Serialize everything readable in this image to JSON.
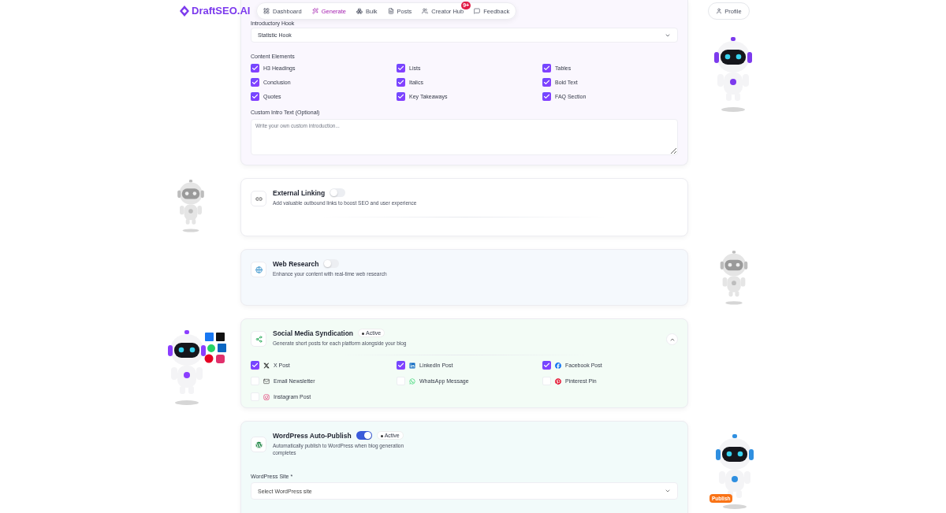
{
  "brand": {
    "name": "DraftSEO.AI"
  },
  "nav": [
    {
      "label": "Dashboard",
      "selected": false,
      "kind": "dashboard"
    },
    {
      "label": "Generate",
      "selected": true,
      "kind": "generate"
    },
    {
      "label": "Bulk",
      "selected": false,
      "kind": "bulk"
    },
    {
      "label": "Posts",
      "selected": false,
      "kind": "posts"
    },
    {
      "label": "Creator Hub",
      "selected": false,
      "kind": "hub",
      "badge": "9+"
    },
    {
      "label": "Feedback",
      "selected": false,
      "kind": "feedback"
    }
  ],
  "profile": {
    "label": "Profile"
  },
  "structure": {
    "hook_label": "Introductory Hook",
    "hook_value": "Statistic Hook",
    "elements_label": "Content Elements",
    "elements": [
      {
        "label": "H3 Headings",
        "checked": true
      },
      {
        "label": "Lists",
        "checked": true
      },
      {
        "label": "Tables",
        "checked": true
      },
      {
        "label": "Conclusion",
        "checked": true
      },
      {
        "label": "Italics",
        "checked": true
      },
      {
        "label": "Bold Text",
        "checked": true
      },
      {
        "label": "Quotes",
        "checked": true
      },
      {
        "label": "Key Takeaways",
        "checked": true
      },
      {
        "label": "FAQ Section",
        "checked": true
      }
    ],
    "intro_label": "Custom Intro Text (Optional)",
    "intro_placeholder": "Write your own custom introduction..."
  },
  "external_linking": {
    "title": "External Linking",
    "description": "Add valuable outbound links to boost SEO and user experience",
    "on": false
  },
  "web_research": {
    "title": "Web Research",
    "description": "Enhance your content with real-time web research",
    "on": false
  },
  "social": {
    "title": "Social Media Syndication",
    "status": "Active",
    "description": "Generate short posts for each platform alongside your blog",
    "expanded": true,
    "options": [
      {
        "label": "X Post",
        "checked": true,
        "kind": "x"
      },
      {
        "label": "LinkedIn Post",
        "checked": true,
        "kind": "linkedin"
      },
      {
        "label": "Facebook Post",
        "checked": true,
        "kind": "facebook"
      },
      {
        "label": "Email Newsletter",
        "checked": false,
        "kind": "email"
      },
      {
        "label": "WhatsApp Message",
        "checked": false,
        "kind": "whatsapp"
      },
      {
        "label": "Pinterest Pin",
        "checked": false,
        "kind": "pinterest"
      },
      {
        "label": "Instagram Post",
        "checked": false,
        "kind": "instagram"
      }
    ]
  },
  "wordpress": {
    "title": "WordPress Auto-Publish",
    "on": true,
    "status": "Active",
    "description": "Automatically publish to WordPress when blog generation completes",
    "site_label": "WordPress Site *",
    "site_placeholder": "Select WordPress site",
    "robot_badge": "Publish"
  }
}
